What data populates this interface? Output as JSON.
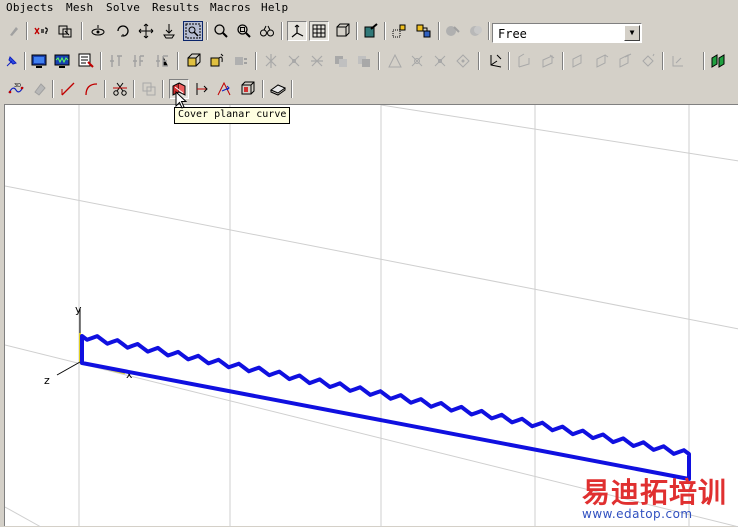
{
  "menu": {
    "items": [
      "Objects",
      "Mesh",
      "Solve",
      "Results",
      "Macros",
      "Help"
    ]
  },
  "toolbar": {
    "mode_select": {
      "value": "Free"
    }
  },
  "tooltip": {
    "text": "Cover planar curve"
  },
  "axes": {
    "x": "x",
    "y": "y",
    "z": "z"
  },
  "watermark": {
    "cn": "易迪拓培训",
    "url": "www.edatop.com"
  },
  "colors": {
    "curve": "#1010e0",
    "axis_x": "#e0d020",
    "grid": "#c8c8c8"
  }
}
